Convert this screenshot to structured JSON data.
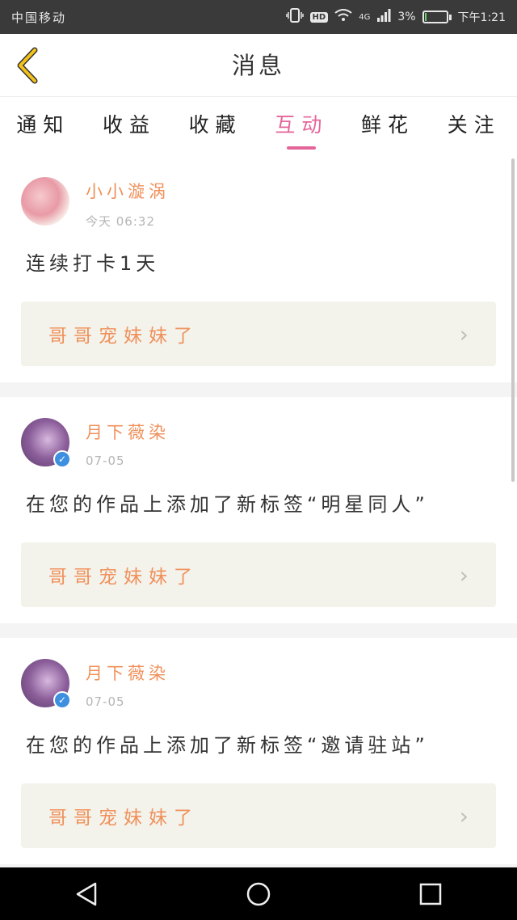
{
  "status_bar": {
    "carrier": "中国移动",
    "network": "4G",
    "battery": "3%",
    "battery_level": 0.03,
    "time": "下午1:21"
  },
  "header": {
    "title": "消息"
  },
  "tabs": [
    {
      "label": "通知",
      "active": false
    },
    {
      "label": "收益",
      "active": false
    },
    {
      "label": "收藏",
      "active": false
    },
    {
      "label": "互动",
      "active": true
    },
    {
      "label": "鲜花",
      "active": false
    },
    {
      "label": "关注",
      "active": false
    }
  ],
  "messages": [
    {
      "username": "小小漩涡",
      "time": "今天 06:32",
      "text": "连续打卡1天",
      "work_title": "哥哥宠妹妹了",
      "verified": false
    },
    {
      "username": "月下薇染",
      "time": "07-05",
      "text": "在您的作品上添加了新标签“明星同人”",
      "work_title": "哥哥宠妹妹了",
      "verified": true
    },
    {
      "username": "月下薇染",
      "time": "07-05",
      "text": "在您的作品上添加了新标签“邀请驻站”",
      "work_title": "哥哥宠妹妹了",
      "verified": true
    }
  ],
  "colors": {
    "accent": "#e5659a",
    "username": "#f0915b",
    "back_arrow": "#f4c21a"
  }
}
